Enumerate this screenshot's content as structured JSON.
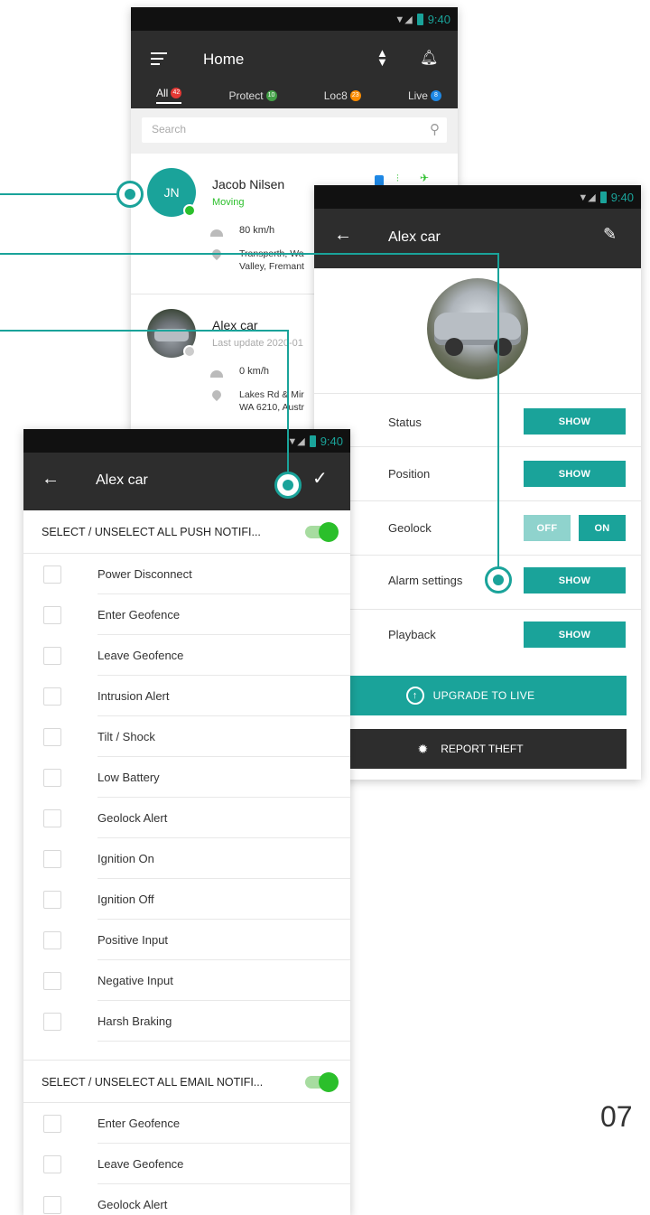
{
  "status_time": "9:40",
  "home": {
    "title": "Home",
    "tabs": [
      {
        "label": "All",
        "badge": "42",
        "badge_color": "#e53935"
      },
      {
        "label": "Protect",
        "badge": "10",
        "badge_color": "#43a047"
      },
      {
        "label": "Loc8",
        "badge": "23",
        "badge_color": "#fb8c00"
      },
      {
        "label": "Live",
        "badge": "8",
        "badge_color": "#1e88e5"
      }
    ],
    "search_placeholder": "Search",
    "devices": [
      {
        "initials": "JN",
        "name": "Jacob Nilsen",
        "status": "Moving",
        "speed": "80 km/h",
        "address_line1": "Transperth, Wa",
        "address_line2": "Valley, Fremant"
      },
      {
        "name": "Alex car",
        "status": "Last update 2020-01",
        "speed": "0 km/h",
        "address_line1": "Lakes Rd & Mir",
        "address_line2": "WA 6210, Austr"
      }
    ]
  },
  "detail": {
    "title": "Alex car",
    "rows": [
      {
        "label": "Status",
        "button": "SHOW"
      },
      {
        "label": "Position",
        "button": "SHOW"
      },
      {
        "label": "Geolock",
        "off": "OFF",
        "on": "ON"
      },
      {
        "label": "Alarm settings",
        "button": "SHOW"
      },
      {
        "label": "Playback",
        "button": "SHOW"
      }
    ],
    "upgrade_label": "UPGRADE TO LIVE",
    "report_label": "REPORT THEFT"
  },
  "notifications": {
    "title": "Alex car",
    "push_header": "SELECT / UNSELECT ALL PUSH NOTIFI...",
    "push_items": [
      "Power Disconnect",
      "Enter Geofence",
      "Leave Geofence",
      "Intrusion Alert",
      "Tilt / Shock",
      "Low Battery",
      "Geolock Alert",
      "Ignition On",
      "Ignition Off",
      "Positive Input",
      "Negative Input",
      "Harsh Braking"
    ],
    "email_header": "SELECT / UNSELECT ALL EMAIL NOTIFI...",
    "email_items": [
      "Enter Geofence",
      "Leave Geofence",
      "Geolock Alert"
    ]
  },
  "page_number": "07",
  "colors": {
    "accent": "#1aa39a",
    "appbar": "#2d2d2d",
    "toggle_on": "#2bbf2b"
  }
}
